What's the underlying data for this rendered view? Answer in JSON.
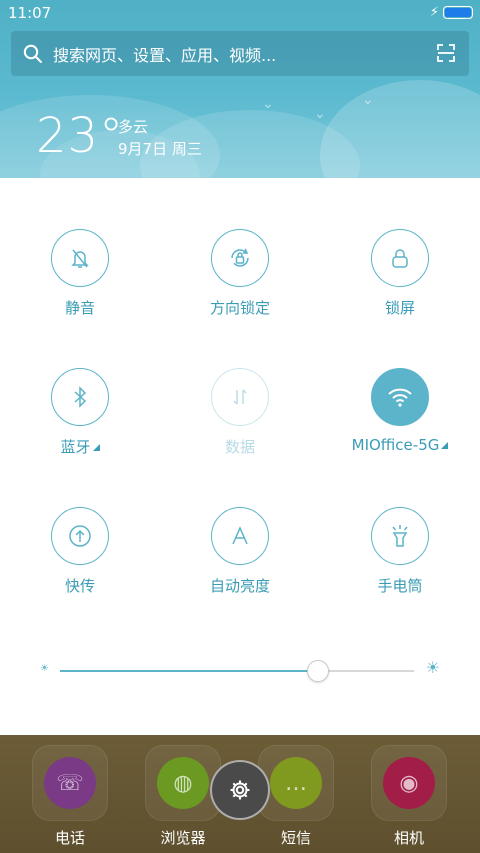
{
  "status_bar": {
    "time": "11:07"
  },
  "search": {
    "placeholder": "搜索网页、设置、应用、视频..."
  },
  "weather": {
    "temperature": "23°",
    "condition": "多云",
    "date": "9月7日 周三"
  },
  "toggles": [
    {
      "label": "静音",
      "icon": "bell-off-icon",
      "state": "off"
    },
    {
      "label": "方向锁定",
      "icon": "rotation-lock-icon",
      "state": "off"
    },
    {
      "label": "锁屏",
      "icon": "lock-icon",
      "state": "off"
    },
    {
      "label": "蓝牙",
      "icon": "bluetooth-icon",
      "state": "off",
      "has_menu": true
    },
    {
      "label": "数据",
      "icon": "data-arrows-icon",
      "state": "disabled"
    },
    {
      "label": "MIOffice-5G",
      "icon": "wifi-icon",
      "state": "on",
      "has_menu": true
    },
    {
      "label": "快传",
      "icon": "quick-transfer-icon",
      "state": "off"
    },
    {
      "label": "自动亮度",
      "icon": "auto-brightness-icon",
      "state": "off"
    },
    {
      "label": "手电筒",
      "icon": "flashlight-icon",
      "state": "off"
    }
  ],
  "brightness": {
    "level": 0.73
  },
  "dock": {
    "apps": [
      {
        "label": "电话",
        "icon": "phone-icon",
        "color": "#7b3a86"
      },
      {
        "label": "浏览器",
        "icon": "browser-icon",
        "color": "#6a9a22"
      },
      {
        "label": "短信",
        "icon": "message-icon",
        "color": "#7f9a1e"
      },
      {
        "label": "相机",
        "icon": "camera-icon",
        "color": "#a21d48"
      }
    ]
  },
  "colors": {
    "accent": "#5bb4c9",
    "header": "#4fb0c6",
    "dock": "#5e4f2e"
  }
}
